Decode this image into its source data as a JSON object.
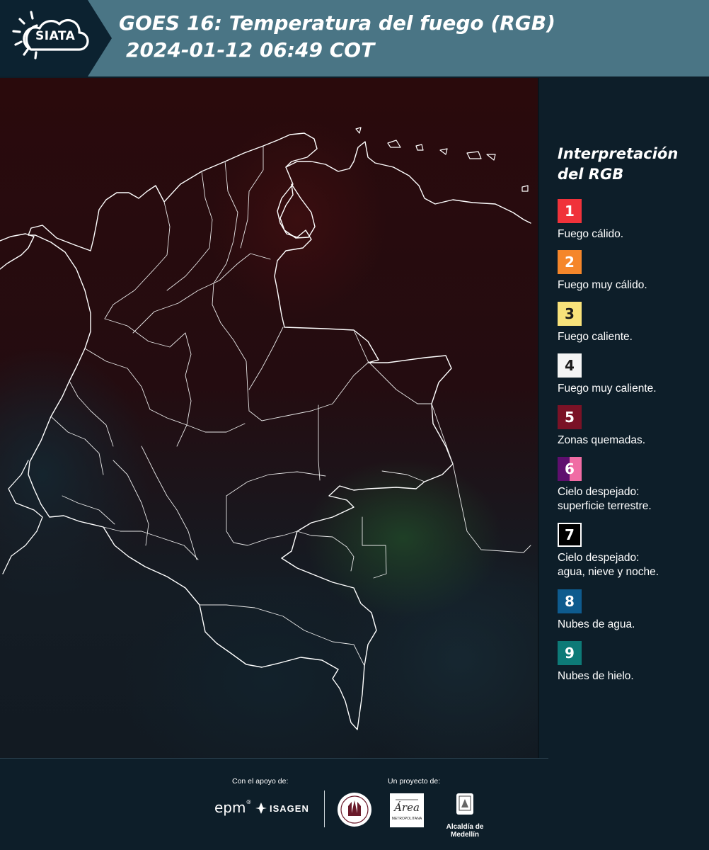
{
  "header": {
    "logo_text": "SIATA",
    "title_line1": "GOES 16: Temperatura del fuego (RGB)",
    "title_line2": "2024-01-12 06:49 COT"
  },
  "legend": {
    "title": "Interpretación del RGB",
    "items": [
      {
        "number": "1",
        "label": "Fuego cálido.",
        "color": "#f0323a"
      },
      {
        "number": "2",
        "label": "Fuego muy cálido.",
        "color": "#f5862a"
      },
      {
        "number": "3",
        "label": "Fuego caliente.",
        "color": "#f8e27a"
      },
      {
        "number": "4",
        "label": "Fuego muy caliente.",
        "color": "#f4f4f4"
      },
      {
        "number": "5",
        "label": "Zonas quemadas.",
        "color": "#7a1226"
      },
      {
        "number": "6",
        "label": "Cielo despejado:",
        "label2": "superficie terrestre.",
        "color": "#5e0f6e",
        "color2": "#f06ca4"
      },
      {
        "number": "7",
        "label": "Cielo despejado:",
        "label2": "agua, nieve y noche.",
        "color": "#000000"
      },
      {
        "number": "8",
        "label": "Nubes de agua.",
        "color": "#0e5b8e"
      },
      {
        "number": "9",
        "label": "Nubes de hielo.",
        "color": "#0d7a77"
      }
    ]
  },
  "footer": {
    "support_label": "Con el apoyo de:",
    "project_label": "Un proyecto de:",
    "epm": "epm",
    "isagen": "ISAGEN",
    "area_text": "Área",
    "area_sub": "METROPOLITANA",
    "alcaldia": "Alcaldía de Medellín"
  }
}
